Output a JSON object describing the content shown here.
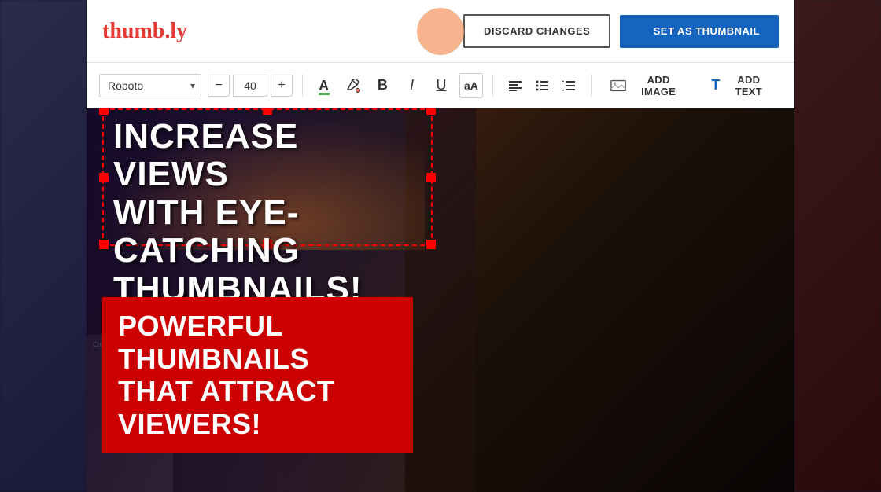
{
  "header": {
    "logo": "thumb.ly",
    "discard_label": "DISCARD CHANGES",
    "set_thumbnail_label": "SET AS THUMBNAIL"
  },
  "toolbar": {
    "font_name": "Roboto",
    "font_size": "40",
    "decrease_label": "−",
    "increase_label": "+",
    "text_color_letter": "A",
    "paint_bucket_letter": "",
    "bold_label": "B",
    "italic_label": "I",
    "underline_label": "U",
    "aa_label": "aA",
    "align_left": "≡",
    "align_list": "≡",
    "align_lines": "≡",
    "add_image_label": "ADD IMAGE",
    "add_text_label": "ADD TEXT"
  },
  "canvas": {
    "heading_line1": "INCREASE VIEWS",
    "heading_line2": "WITH EYE-CATCHING",
    "heading_line3": "THUMBNAILS!",
    "banner_line1": "POWERFUL THUMBNAILS",
    "banner_line2": "THAT ATTRACT VIEWERS!"
  }
}
